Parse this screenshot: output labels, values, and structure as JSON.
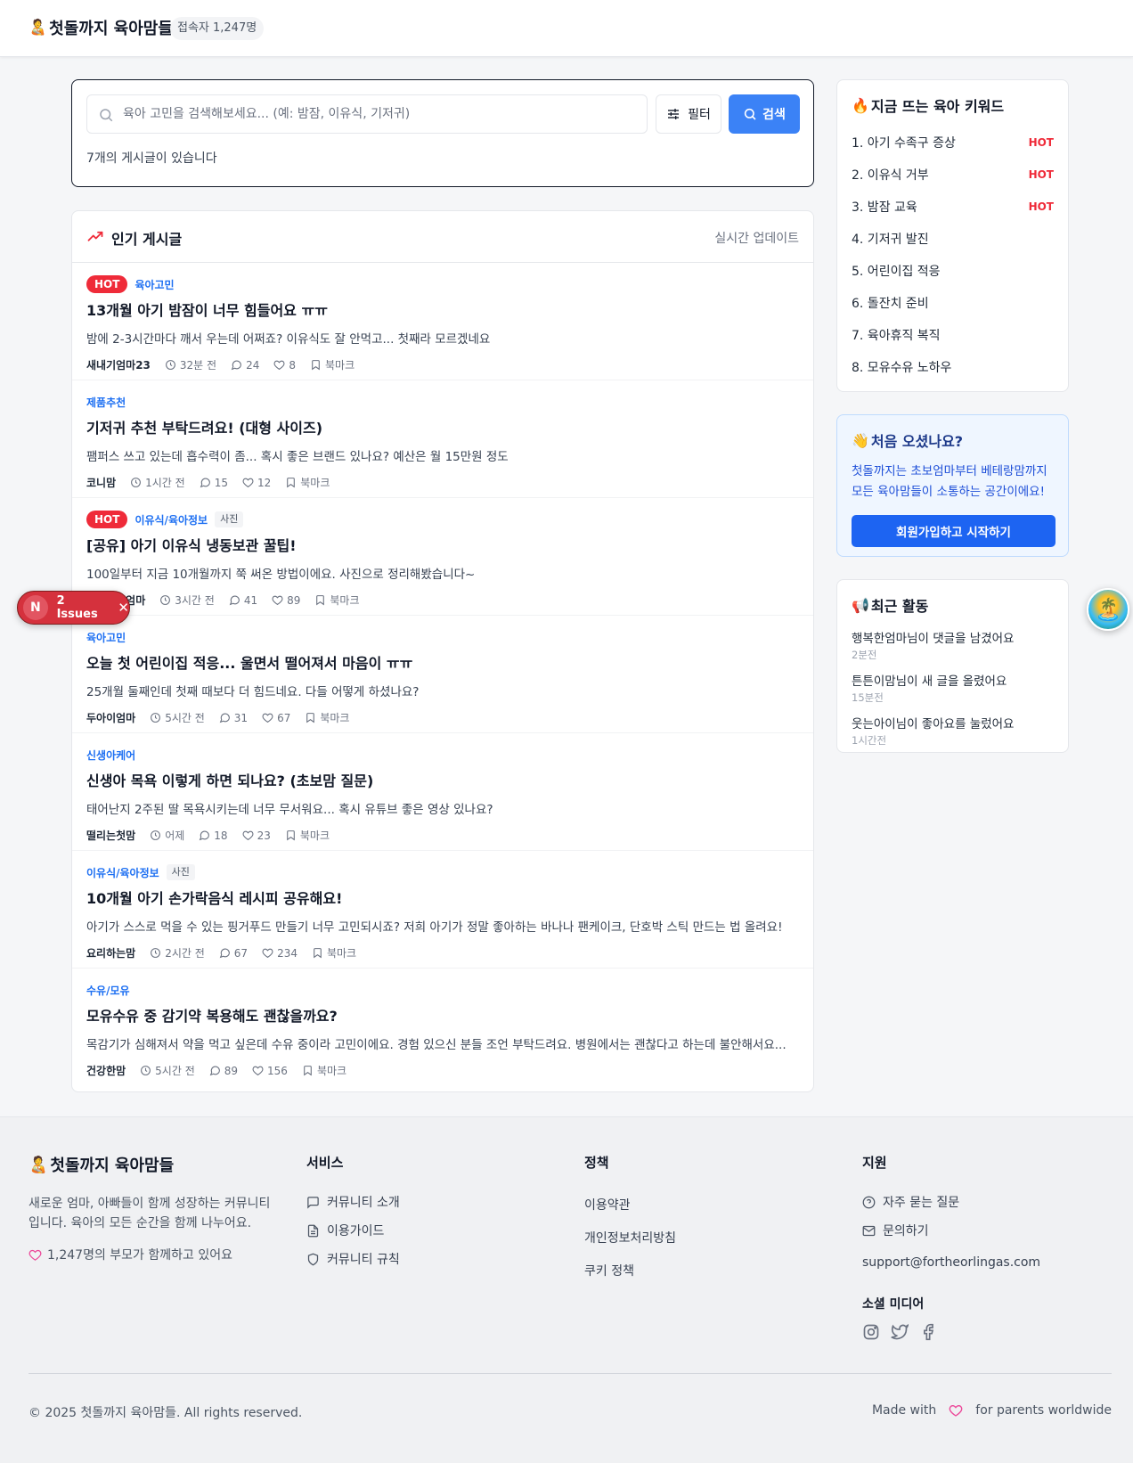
{
  "header": {
    "brand_emoji": "🧑‍🍼",
    "brand_name": "첫돌까지 육아맘들",
    "visitors": "접속자 1,247명"
  },
  "search": {
    "placeholder": "육아 고민을 검색해보세요... (예: 밤잠, 이유식, 기저귀)",
    "value": "",
    "filter_label": "필터",
    "search_label": "검색",
    "result_count": "7개의 게시글이 있습니다"
  },
  "posts_section": {
    "title": "인기 게시글",
    "realtime": "실시간 업데이트",
    "bookmark_label": "북마크",
    "posts": [
      {
        "hot": "HOT",
        "category": "육아고민",
        "photo": "",
        "title": "13개월 아기 밤잠이 너무 힘들어요 ㅠㅠ",
        "excerpt": "밤에 2-3시간마다 깨서 우는데 어쩌죠? 이유식도 잘 안먹고... 첫째라 모르겠네요",
        "author": "새내기엄마23",
        "time": "32분 전",
        "comments": "24",
        "likes": "8"
      },
      {
        "hot": "",
        "category": "제품추천",
        "photo": "",
        "title": "기저귀 추천 부탁드려요! (대형 사이즈)",
        "excerpt": "팸퍼스 쓰고 있는데 흡수력이 좀... 혹시 좋은 브랜드 있나요? 예산은 월 15만원 정도",
        "author": "코니맘",
        "time": "1시간 전",
        "comments": "15",
        "likes": "12"
      },
      {
        "hot": "HOT",
        "category": "이유식/육아정보",
        "photo": "사진",
        "title": "[공유] 아기 이유식 냉동보관 꿀팁!",
        "excerpt": "100일부터 지금 10개월까지 쭉 써온 방법이에요. 사진으로 정리해봤습니다~",
        "author": "요리하는엄마",
        "time": "3시간 전",
        "comments": "41",
        "likes": "89"
      },
      {
        "hot": "",
        "category": "육아고민",
        "photo": "",
        "title": "오늘 첫 어린이집 적응... 울면서 떨어져서 마음이 ㅠㅠ",
        "excerpt": "25개월 둘째인데 첫째 때보다 더 힘드네요. 다들 어떻게 하셨나요?",
        "author": "두아이엄마",
        "time": "5시간 전",
        "comments": "31",
        "likes": "67"
      },
      {
        "hot": "",
        "category": "신생아케어",
        "photo": "",
        "title": "신생아 목욕 이렇게 하면 되나요? (초보맘 질문)",
        "excerpt": "태어난지 2주된 딸 목욕시키는데 너무 무서워요... 혹시 유튜브 좋은 영상 있나요?",
        "author": "떨리는첫맘",
        "time": "어제",
        "comments": "18",
        "likes": "23"
      },
      {
        "hot": "",
        "category": "이유식/육아정보",
        "photo": "사진",
        "title": "10개월 아기 손가락음식 레시피 공유해요!",
        "excerpt": "아기가 스스로 먹을 수 있는 핑거푸드 만들기 너무 고민되시죠? 저희 아기가 정말 좋아하는 바나나 팬케이크, 단호박 스틱 만드는 법 올려요!",
        "author": "요리하는맘",
        "time": "2시간 전",
        "comments": "67",
        "likes": "234"
      },
      {
        "hot": "",
        "category": "수유/모유",
        "photo": "",
        "title": "모유수유 중 감기약 복용해도 괜찮을까요?",
        "excerpt": "목감기가 심해져서 약을 먹고 싶은데 수유 중이라 고민이에요. 경험 있으신 분들 조언 부탁드려요. 병원에서는 괜찮다고 하는데 불안해서요...",
        "author": "건강한맘",
        "time": "5시간 전",
        "comments": "89",
        "likes": "156"
      }
    ]
  },
  "keywords": {
    "emoji": "🔥",
    "title": "지금 뜨는 육아 키워드",
    "items": [
      {
        "label": "1. 아기 수족구 증상",
        "badge": "HOT"
      },
      {
        "label": "2. 이유식 거부",
        "badge": "HOT"
      },
      {
        "label": "3. 밤잠 교육",
        "badge": "HOT"
      },
      {
        "label": "4. 기저귀 발진",
        "badge": ""
      },
      {
        "label": "5. 어린이집 적응",
        "badge": ""
      },
      {
        "label": "6. 돌잔치 준비",
        "badge": ""
      },
      {
        "label": "7. 육아휴직 복직",
        "badge": ""
      },
      {
        "label": "8. 모유수유 노하우",
        "badge": ""
      }
    ]
  },
  "welcome": {
    "emoji": "👋",
    "title": "처음 오셨나요?",
    "line1": "첫돌까지는 초보엄마부터 베테랑맘까지",
    "line2": "모든 육아맘들이 소통하는 공간이에요!",
    "button": "회원가입하고 시작하기"
  },
  "activity": {
    "emoji": "📢",
    "title": "최근 활동",
    "items": [
      {
        "text": "행복한엄마님이 댓글을 남겼어요",
        "ago": "2분전"
      },
      {
        "text": "튼튼이맘님이 새 글을 올렸어요",
        "ago": "15분전"
      },
      {
        "text": "웃는아이님이 좋아요를 눌렀어요",
        "ago": "1시간전"
      }
    ]
  },
  "issues": {
    "badge": "N",
    "label": "2 Issues",
    "close": "✕"
  },
  "assistant_avatar": "🏝️",
  "footer": {
    "brand_emoji": "🧑‍🍼",
    "brand_name": "첫돌까지 육아맘들",
    "description": "새로운 엄마, 아빠들이 함께 성장하는 커뮤니티입니다. 육아의 모든 순간을 함께 나누어요.",
    "together": "1,247명의 부모가 함께하고 있어요",
    "service": {
      "title": "서비스",
      "items": [
        "커뮤니티 소개",
        "이용가이드",
        "커뮤니티 규칙"
      ]
    },
    "policy": {
      "title": "정책",
      "items": [
        "이용약관",
        "개인정보처리방침",
        "쿠키 정책"
      ]
    },
    "support": {
      "title": "지원",
      "faq": "자주 묻는 질문",
      "contact": "문의하기",
      "email": "support@fortheorlingas.com",
      "social_title": "소셜 미디어"
    },
    "copyright": "© 2025 첫돌까지 육아맘들. All rights reserved.",
    "made_with": "Made with",
    "for_parents": "for parents worldwide"
  },
  "colors": {
    "accent": "#3b82f6",
    "hot": "#ef2b39",
    "category": "#1d6ff2",
    "heart": "#ec4899"
  }
}
